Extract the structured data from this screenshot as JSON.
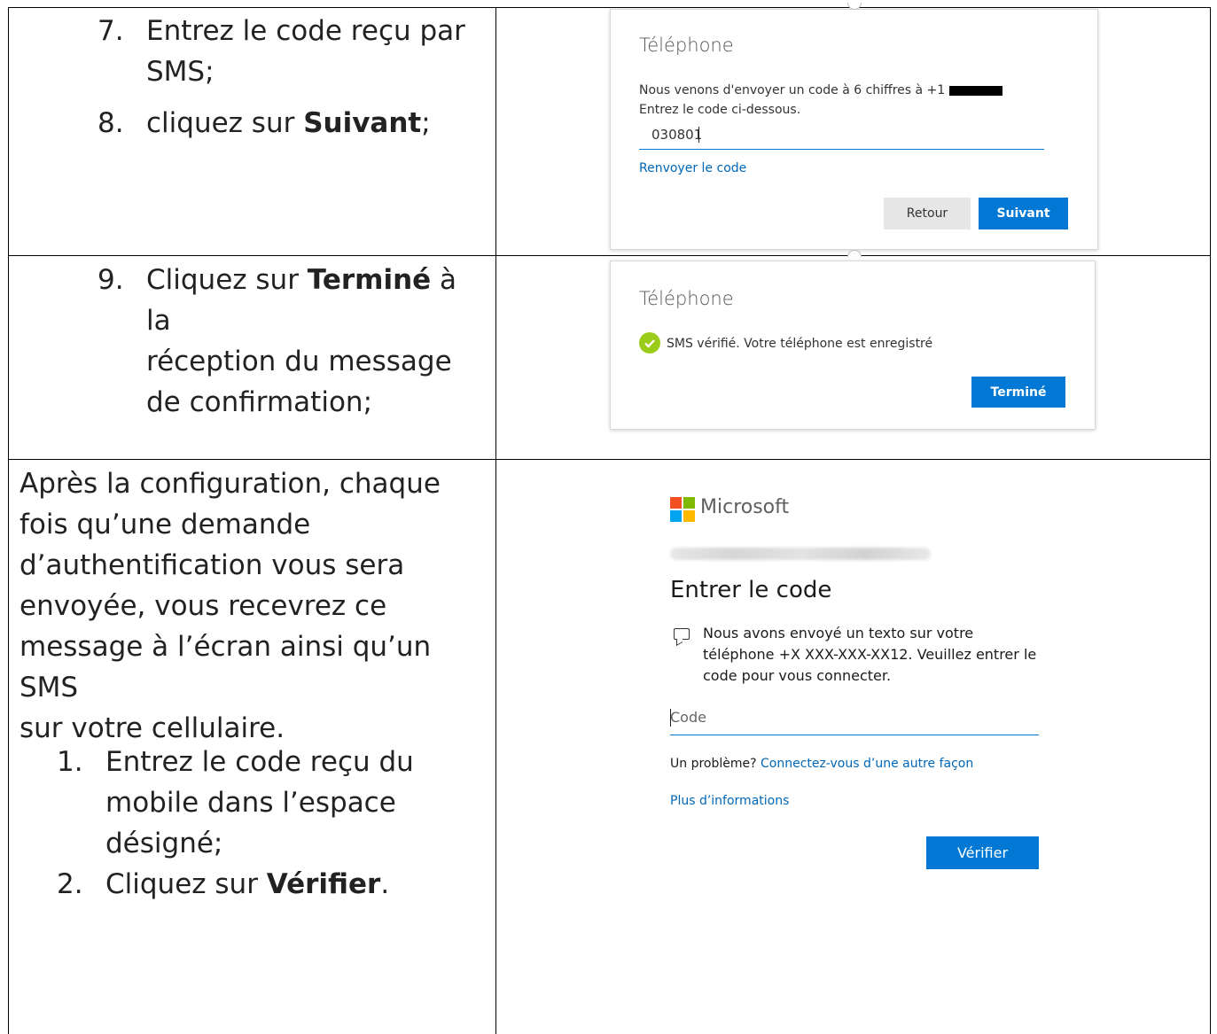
{
  "row1": {
    "steps": [
      {
        "num": "7.",
        "line1": "Entrez le code reçu par",
        "line2": "SMS;"
      },
      {
        "num": "8.",
        "pre": "cliquez sur ",
        "bold": "Suivant",
        "post": ";"
      }
    ],
    "card": {
      "title": "Téléphone",
      "message_line1": "Nous venons d'envoyer un code à 6 chiffres à +1",
      "message_line2": "Entrez le code ci-dessous.",
      "code_value": "030801",
      "resend_link": "Renvoyer le code",
      "back_button": "Retour",
      "next_button": "Suivant"
    }
  },
  "row2": {
    "step": {
      "num": "9.",
      "pre": "Cliquez sur ",
      "bold": "Terminé",
      "post": " à la",
      "line2": "réception du message",
      "line3": "de confirmation;"
    },
    "card": {
      "title": "Téléphone",
      "status": "SMS vérifié. Votre téléphone est enregistré",
      "done_button": "Terminé"
    }
  },
  "row3": {
    "paragraph": [
      "Après la configuration, chaque",
      "fois qu’une demande",
      "d’authentification vous sera",
      "envoyée, vous recevrez ce",
      "message à l’écran ainsi qu’un SMS",
      "sur votre cellulaire."
    ],
    "steps": [
      {
        "num": "1.",
        "line1": "Entrez le code reçu du",
        "line2": "mobile dans l’espace",
        "line3": "désigné;"
      },
      {
        "num": "2.",
        "pre": "Cliquez sur ",
        "bold": "Vérifier",
        "post": "."
      }
    ],
    "signin": {
      "brand": "Microsoft",
      "heading": "Entrer le code",
      "message": "Nous avons envoyé un texto sur votre téléphone +X XXX-XXX-XX12. Veuillez entrer le code pour vous connecter.",
      "code_placeholder": "Code",
      "problem_text": "Un problème? ",
      "problem_link": "Connectez-vous d’une autre façon",
      "more_info_link": "Plus d’informations",
      "verify_button": "Vérifier"
    }
  },
  "colors": {
    "accent": "#0078d4",
    "link": "#0067b8",
    "check": "#9ccc1a",
    "ms_red": "#f25022",
    "ms_green": "#7fba00",
    "ms_blue": "#00a4ef",
    "ms_yellow": "#ffb900"
  }
}
